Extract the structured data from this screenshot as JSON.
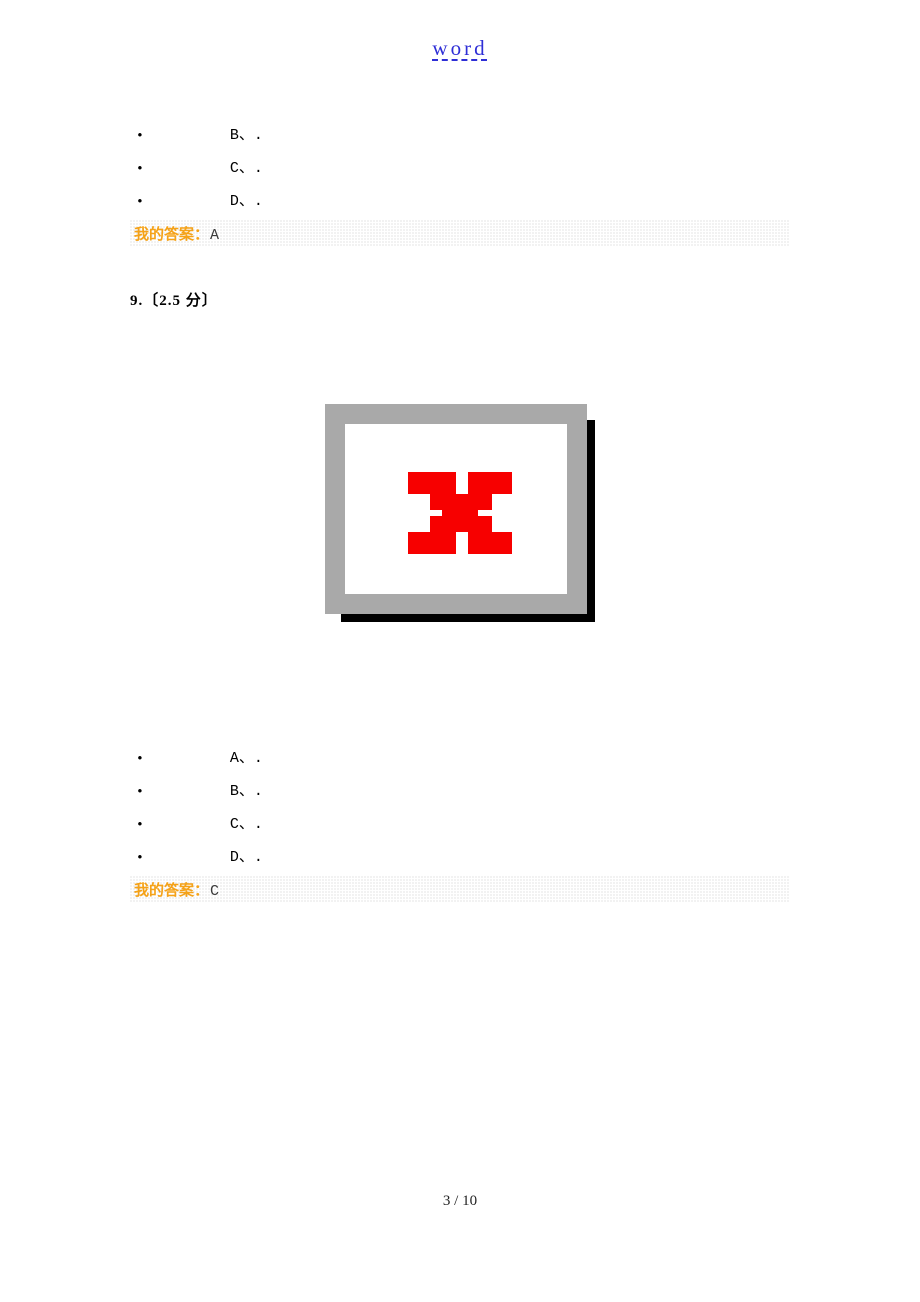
{
  "header": {
    "link_text": "word"
  },
  "block1_options": [
    "B、.",
    "C、.",
    "D、."
  ],
  "block1_answer_label": "我的答案：",
  "block1_answer_value": "A",
  "q9_heading": "9.〔2.5 分〕",
  "block2_options": [
    "A、.",
    "B、.",
    "C、.",
    "D、."
  ],
  "block2_answer_label": "我的答案：",
  "block2_answer_value": "C",
  "footer": "3 / 10"
}
